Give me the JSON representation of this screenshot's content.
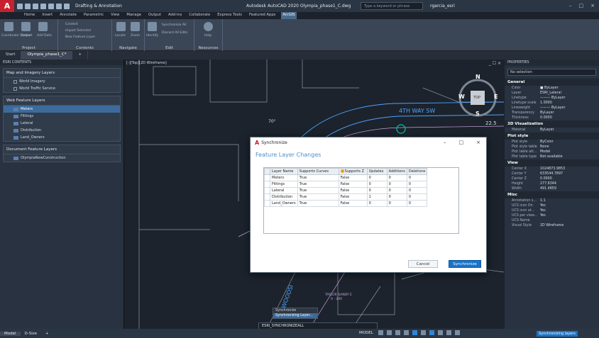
{
  "titlebar": {
    "logo": "A",
    "workspace": "Drafting & Annotation",
    "title": "Autodesk AutoCAD 2020   Olympia_phase1_C.dwg",
    "search_placeholder": "Type a keyword or phrase",
    "user": "rgarcia_esri",
    "controls": [
      "–",
      "□",
      "×"
    ]
  },
  "ribbon_tabs": [
    "Home",
    "Insert",
    "Annotate",
    "Parametric",
    "View",
    "Manage",
    "Output",
    "Add-ins",
    "Collaborate",
    "Express Tools",
    "Featured Apps",
    "ArcGIS"
  ],
  "ribbon_active_tab": "ArcGIS",
  "ribbon_groups": [
    {
      "title": "Project",
      "items": [
        "Coordinate System",
        "Project",
        "Add Data"
      ]
    },
    {
      "title": "Contents",
      "items": [
        "Content",
        "Import Selected",
        "New Feature Layer"
      ]
    },
    {
      "title": "Navigate",
      "items": [
        "Locate",
        "Zoom"
      ]
    },
    {
      "title": "Edit",
      "items": [
        "Identify",
        "Synchronize All",
        "Discard All Edits"
      ]
    },
    {
      "title": "Resources",
      "items": [
        "Help"
      ]
    }
  ],
  "doc_tabs": [
    "Start",
    "Olympia_phase1_C*",
    "+"
  ],
  "left_panel": {
    "header": "ESRI CONTENTS",
    "groups": [
      {
        "title": "Map and Imagery Layers",
        "items": [
          "World Imagery",
          "World Traffic Service"
        ]
      },
      {
        "title": "Web Feature Layers",
        "items": [
          "Meters",
          "Fittings",
          "Lateral",
          "Distribution",
          "Land_Owners"
        ],
        "selected": "Meters"
      },
      {
        "title": "Document Feature Layers",
        "items": [
          "OlympiaNewConstruction"
        ]
      }
    ]
  },
  "viewport": {
    "label": "[-][Top][2D Wireframe]",
    "street": "4TH WAY SW",
    "angle": "70°",
    "dimension": "22.5",
    "parcel_owner": "TAYLOR  SANDY E",
    "parcel_area": "A : 200",
    "street_label_vertical": "WOODSI",
    "compass": {
      "n": "N",
      "s": "S",
      "e": "E",
      "w": "W",
      "center": "TOP"
    },
    "controls": "_ ☐ ×"
  },
  "properties": {
    "header": "PROPERTIES",
    "selection": "No selection",
    "sections": [
      {
        "title": "General",
        "rows": [
          [
            "Color",
            "■ ByLayer"
          ],
          [
            "Layer",
            "ESRI_Lateral"
          ],
          [
            "Linetype",
            "——— ByLayer"
          ],
          [
            "Linetype scale",
            "1.0000"
          ],
          [
            "Lineweight",
            "——— ByLayer"
          ],
          [
            "Transparency",
            "ByLayer"
          ],
          [
            "Thickness",
            "0.0000"
          ]
        ]
      },
      {
        "title": "3D Visualization",
        "rows": [
          [
            "Material",
            "ByLayer"
          ]
        ]
      },
      {
        "title": "Plot style",
        "rows": [
          [
            "Plot style",
            "ByColor"
          ],
          [
            "Plot style table",
            "None"
          ],
          [
            "Plot table att...",
            "Model"
          ],
          [
            "Plot table type",
            "Not available"
          ]
        ]
      },
      {
        "title": "View",
        "rows": [
          [
            "Center X",
            "1024873.9853"
          ],
          [
            "Center Y",
            "633544.7897"
          ],
          [
            "Center Z",
            "0.0000"
          ],
          [
            "Height",
            "277.8344"
          ],
          [
            "Width",
            "491.4859"
          ]
        ]
      },
      {
        "title": "Misc",
        "rows": [
          [
            "Annotation s...",
            "1:1"
          ],
          [
            "UCS icon On",
            "Yes"
          ],
          [
            "UCS icon at...",
            "Yes"
          ],
          [
            "UCS per view...",
            "Yes"
          ],
          [
            "UCS Name",
            ""
          ],
          [
            "Visual Style",
            "2D Wireframe"
          ]
        ]
      }
    ]
  },
  "dialog": {
    "logo": "A",
    "title": "Synchronize",
    "heading": "Feature Layer Changes",
    "controls": [
      "–",
      "□",
      "×"
    ],
    "columns": [
      "Layer Name",
      "Supports Curves",
      "Supports Z",
      "Updates",
      "Additions",
      "Deletions"
    ],
    "rows": [
      [
        "Meters",
        "True",
        "False",
        "0",
        "0",
        "0"
      ],
      [
        "Fittings",
        "True",
        "False",
        "0",
        "0",
        "0"
      ],
      [
        "Lateral",
        "True",
        "False",
        "0",
        "0",
        "0"
      ],
      [
        "Distribution",
        "True",
        "False",
        "1",
        "0",
        "0"
      ],
      [
        "Land_Owners",
        "True",
        "False",
        "0",
        "0",
        "0"
      ]
    ],
    "cancel_label": "Cancel",
    "sync_label": "Synchronize"
  },
  "command": {
    "value": "ESRI_SYNCHRONIZEALL",
    "popup": [
      "Synchronize",
      "Synchronizing Layer..."
    ]
  },
  "status": {
    "tabs": [
      "Model",
      "D-Size",
      "+"
    ],
    "mode": "MODEL",
    "right_label": "Synchronizing layers"
  },
  "colors": {
    "accent": "#1a73c8",
    "street": "#4da3ff",
    "parcel": "#9aa5b3",
    "highlight": "#00c8a0"
  }
}
